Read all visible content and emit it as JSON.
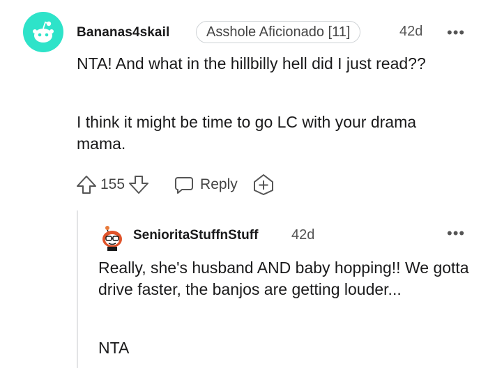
{
  "comment": {
    "avatar_icon": "snoo-avatar-icon",
    "avatar_color": "#2ee3c9",
    "username": "Bananas4skail",
    "flair": "Asshole Aficionado [11]",
    "time": "42d",
    "more": "•••",
    "paragraphs": [
      "NTA! And what in the hillbilly hell did I just read??",
      "I think it might be time to go LC with your drama mama."
    ],
    "actions": {
      "upvote_icon": "upvote-arrow-icon",
      "score": "155",
      "downvote_icon": "downvote-arrow-icon",
      "reply_icon": "speech-bubble-icon",
      "reply_label": "Reply",
      "award_icon": "award-plus-icon"
    }
  },
  "reply": {
    "avatar_icon": "snoo-custom-avatar-icon",
    "username": "SenioritaStuffnStuff",
    "time": "42d",
    "more": "•••",
    "paragraphs": [
      "Really, she's husband AND baby hopping!! We gotta drive faster, the banjos are getting louder...",
      "NTA"
    ]
  }
}
